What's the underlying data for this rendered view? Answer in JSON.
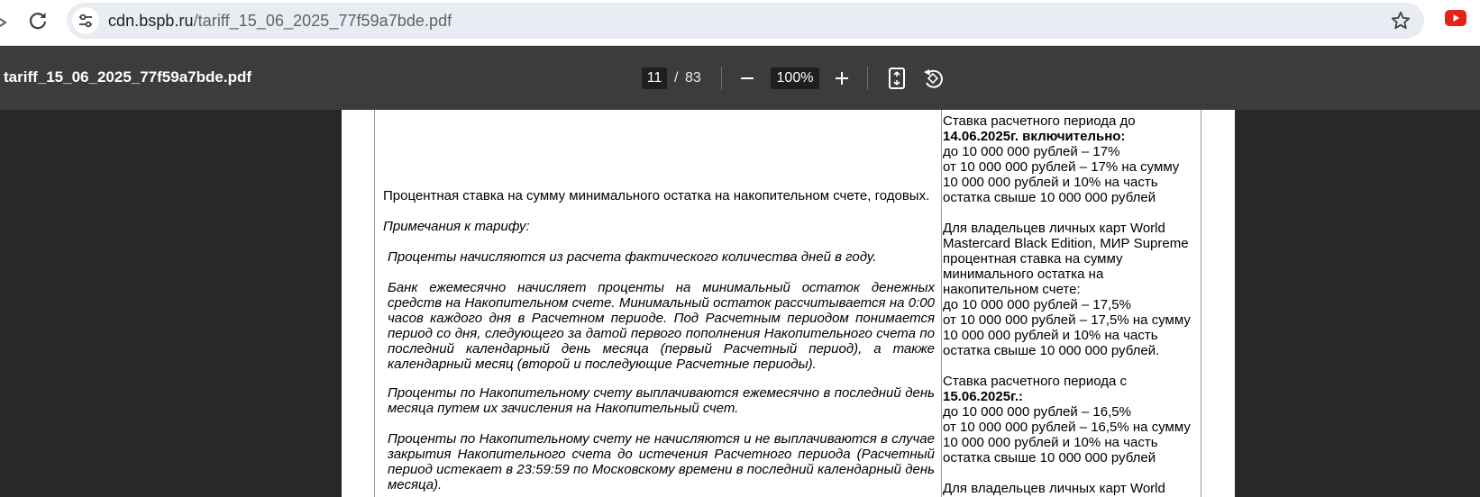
{
  "browser": {
    "url_domain": "cdn.bspb.ru",
    "url_path": "/tariff_15_06_2025_77f59a7bde.pdf"
  },
  "pdf_toolbar": {
    "title": "tariff_15_06_2025_77f59a7bde.pdf",
    "current_page": "11",
    "page_separator": "/",
    "total_pages": "83",
    "zoom": "100%"
  },
  "document": {
    "left": {
      "rate_label": "Процентная ставка на сумму минимального остатка на накопительном счете, годовых.",
      "notes_heading": "Примечания к тарифу:",
      "note_1": "Проценты начисляются из расчета фактического количества дней в году.",
      "note_2": "Банк ежемесячно начисляет проценты на минимальный остаток денежных средств на Накопительном счете. Минимальный остаток рассчитывается на 0:00 часов каждого дня в Расчетном периоде. Под Расчетным периодом понимается период со дня, следующего за датой первого пополнения Накопительного счета по последний календарный день месяца (первый Расчетный период), а также календарный месяц (второй и последующие Расчетные периоды).",
      "note_3": "Проценты по Накопительному счету выплачиваются ежемесячно в последний день месяца путем их зачисления на Накопительный счет.",
      "note_4": "Проценты по Накопительному счету не начисляются и не выплачиваются в случае закрытия Накопительного счета до истечения Расчетного периода (Расчетный период истекает в 23:59:59 по Московскому времени в последний календарный день месяца)."
    },
    "right": {
      "l1": "Ставка расчетного периода до",
      "l2": "14.06.2025г. включительно:",
      "l3": "до 10 000 000 рублей – 17%",
      "l4": "от 10 000 000 рублей – 17% на сумму",
      "l5": "10 000 000 рублей и 10% на часть",
      "l6": "остатка свыше 10 000 000 рублей",
      "l7": "Для владельцев личных карт World",
      "l8": "Mastercard Black Edition, МИР Supreme",
      "l9": "процентная ставка на сумму",
      "l10": "минимального остатка на",
      "l11": "накопительном счете:",
      "l12": "до 10 000 000 рублей – 17,5%",
      "l13": "от 10 000 000 рублей – 17,5% на сумму",
      "l14": "10 000 000 рублей и 10% на часть",
      "l15": "остатка свыше 10 000 000 рублей.",
      "l16": "Ставка расчетного периода с",
      "l17": "15.06.2025г.:",
      "l18": "до 10 000 000 рублей – 16,5%",
      "l19": "от 10 000 000 рублей – 16,5% на сумму",
      "l20": "10 000 000 рублей и 10% на часть",
      "l21": "остатка свыше 10 000 000 рублей",
      "l22": "Для владельцев личных карт World"
    }
  }
}
